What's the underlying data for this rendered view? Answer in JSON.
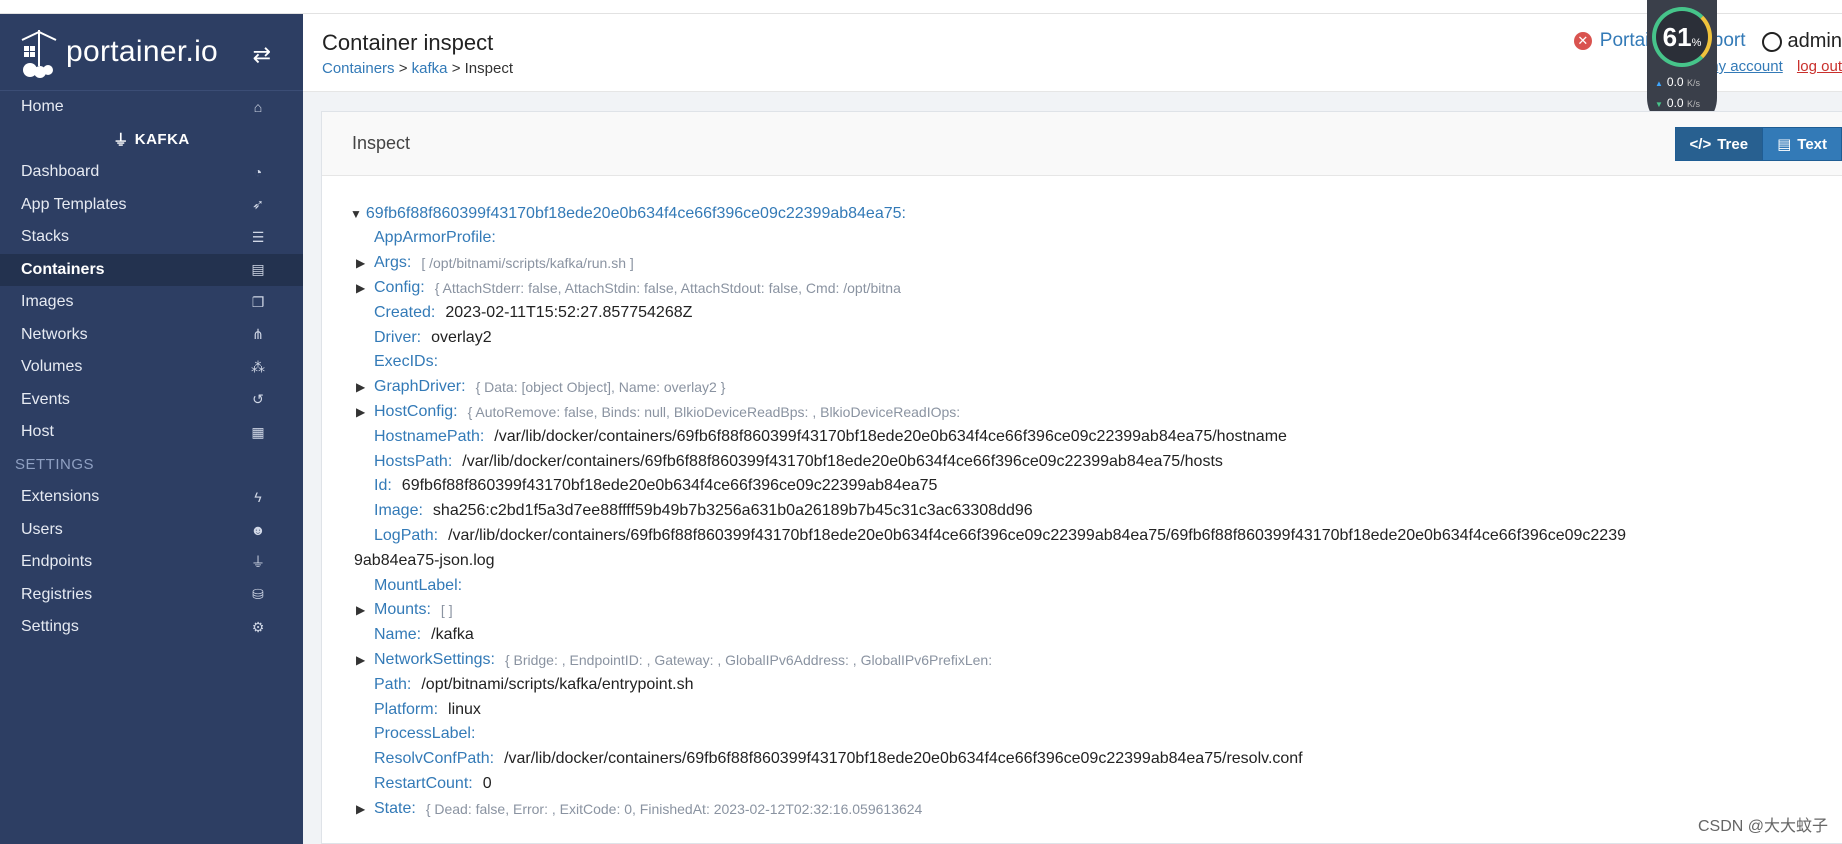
{
  "brand": {
    "name": "portainer.io"
  },
  "sidebar": {
    "home": "Home",
    "endpoint": "KAFKA",
    "items": [
      {
        "label": "Dashboard",
        "icon": "dashboard-icon"
      },
      {
        "label": "App Templates",
        "icon": "rocket-icon"
      },
      {
        "label": "Stacks",
        "icon": "list-icon"
      },
      {
        "label": "Containers",
        "icon": "server-icon",
        "active": true
      },
      {
        "label": "Images",
        "icon": "clone-icon"
      },
      {
        "label": "Networks",
        "icon": "sitemap-icon"
      },
      {
        "label": "Volumes",
        "icon": "cubes-icon"
      },
      {
        "label": "Events",
        "icon": "history-icon"
      },
      {
        "label": "Host",
        "icon": "grid-icon"
      }
    ],
    "settings_header": "SETTINGS",
    "settings_items": [
      {
        "label": "Extensions",
        "icon": "bolt-icon"
      },
      {
        "label": "Users",
        "icon": "users-icon"
      },
      {
        "label": "Endpoints",
        "icon": "plug-icon"
      },
      {
        "label": "Registries",
        "icon": "database-icon"
      },
      {
        "label": "Settings",
        "icon": "cogs-icon"
      }
    ]
  },
  "header": {
    "title": "Container inspect",
    "breadcrumb": {
      "containers": "Containers",
      "sep1": ">",
      "kafka": "kafka",
      "sep2": ">",
      "current": "Inspect"
    },
    "support": "Portainer support",
    "user": "admin",
    "my_account": "my account",
    "log_out": "log out"
  },
  "speed_widget": {
    "percent": "61",
    "percent_unit": "%",
    "up": "0.0",
    "down": "0.0",
    "unit": "K/s"
  },
  "panel": {
    "title": "Inspect",
    "tree_label": "Tree",
    "text_label": "Text"
  },
  "inspect": {
    "root": "69fb6f88f860399f43170bf18ede20e0b634f4ce66f396ce09c22399ab84ea75:",
    "rows": [
      {
        "key": "AppArmorProfile:",
        "val": "",
        "expandable": false
      },
      {
        "key": "Args:",
        "preview": "[ /opt/bitnami/scripts/kafka/run.sh ]",
        "expandable": true
      },
      {
        "key": "Config:",
        "preview": "{ AttachStderr: false, AttachStdin: false, AttachStdout: false, Cmd: /opt/bitna",
        "expandable": true
      },
      {
        "key": "Created:",
        "val": "2023-02-11T15:52:27.857754268Z",
        "expandable": false
      },
      {
        "key": "Driver:",
        "val": "overlay2",
        "expandable": false
      },
      {
        "key": "ExecIDs:",
        "val": "",
        "expandable": false
      },
      {
        "key": "GraphDriver:",
        "preview": "{ Data: [object Object], Name: overlay2 }",
        "expandable": true
      },
      {
        "key": "HostConfig:",
        "preview": "{ AutoRemove: false, Binds: null, BlkioDeviceReadBps: , BlkioDeviceReadIOps:",
        "expandable": true
      },
      {
        "key": "HostnamePath:",
        "val": "/var/lib/docker/containers/69fb6f88f860399f43170bf18ede20e0b634f4ce66f396ce09c22399ab84ea75/hostname",
        "expandable": false
      },
      {
        "key": "HostsPath:",
        "val": "/var/lib/docker/containers/69fb6f88f860399f43170bf18ede20e0b634f4ce66f396ce09c22399ab84ea75/hosts",
        "expandable": false
      },
      {
        "key": "Id:",
        "val": "69fb6f88f860399f43170bf18ede20e0b634f4ce66f396ce09c22399ab84ea75",
        "expandable": false
      },
      {
        "key": "Image:",
        "val": "sha256:c2bd1f5a3d7ee88ffff59b49b7b3256a631b0a26189b7b45c31c3ac63308dd96",
        "expandable": false
      },
      {
        "key": "LogPath:",
        "val": "/var/lib/docker/containers/69fb6f88f860399f43170bf18ede20e0b634f4ce66f396ce09c22399ab84ea75/69fb6f88f860399f43170bf18ede20e0b634f4ce66f396ce09c2239",
        "expandable": false
      }
    ],
    "logpath_wrap": "9ab84ea75-json.log",
    "rows2": [
      {
        "key": "MountLabel:",
        "val": "",
        "expandable": false
      },
      {
        "key": "Mounts:",
        "preview": "[ ]",
        "expandable": true
      },
      {
        "key": "Name:",
        "val": "/kafka",
        "expandable": false
      },
      {
        "key": "NetworkSettings:",
        "preview": "{ Bridge: , EndpointID: , Gateway: , GlobalIPv6Address: , GlobalIPv6PrefixLen:",
        "expandable": true
      },
      {
        "key": "Path:",
        "val": "/opt/bitnami/scripts/kafka/entrypoint.sh",
        "expandable": false
      },
      {
        "key": "Platform:",
        "val": "linux",
        "expandable": false
      },
      {
        "key": "ProcessLabel:",
        "val": "",
        "expandable": false
      },
      {
        "key": "ResolvConfPath:",
        "val": "/var/lib/docker/containers/69fb6f88f860399f43170bf18ede20e0b634f4ce66f396ce09c22399ab84ea75/resolv.conf",
        "expandable": false
      },
      {
        "key": "RestartCount:",
        "val": "0",
        "expandable": false
      },
      {
        "key": "State:",
        "preview": "{ Dead: false, Error: , ExitCode: 0, FinishedAt: 2023-02-12T02:32:16.059613624",
        "expandable": true
      }
    ]
  },
  "watermark": "CSDN @大大蚊子"
}
